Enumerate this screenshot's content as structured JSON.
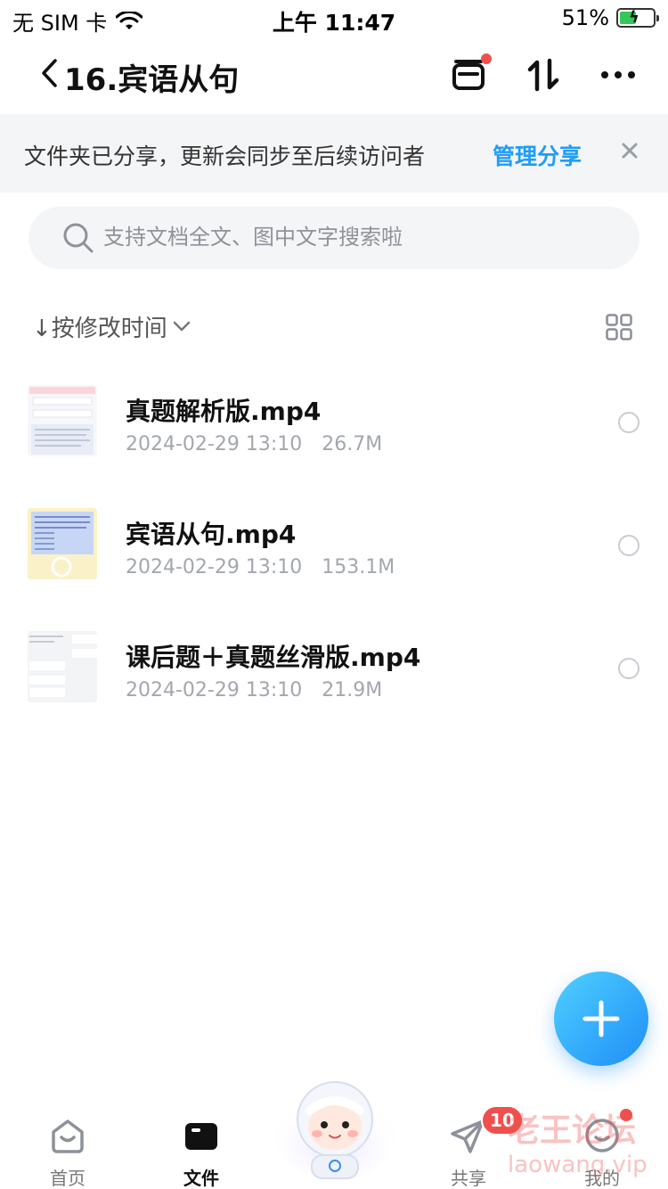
{
  "status_bar": {
    "carrier": "无 SIM 卡",
    "time": "上午 11:47",
    "battery": "51%",
    "battery_level": 0.51
  },
  "navbar": {
    "title": "16.宾语从句",
    "back_icon": "chevron-left-icon",
    "icons": [
      "inbox-box-icon",
      "sort-arrows-icon",
      "more-dots-icon"
    ]
  },
  "banner": {
    "message": "文件夹已分享，更新会同步至后续访问者",
    "action": "管理分享"
  },
  "search": {
    "placeholder": "支持文档全文、图中文字搜索啦"
  },
  "sort": {
    "label": "↓按修改时间"
  },
  "files": [
    {
      "name": "真题解析版.mp4",
      "date": "2024-02-29 13:10",
      "size": "26.7M"
    },
    {
      "name": "宾语从句.mp4",
      "date": "2024-02-29 13:10",
      "size": "153.1M"
    },
    {
      "name": "课后题＋真题丝滑版.mp4",
      "date": "2024-02-29 13:10",
      "size": "21.9M"
    }
  ],
  "tabbar": {
    "home": "首页",
    "files": "文件",
    "share": "共享",
    "mine": "我的",
    "share_badge": "10"
  },
  "watermark": {
    "line1": "老王论坛",
    "line2": "laowang.vip"
  },
  "colors": {
    "accent": "#1f9df7",
    "badge": "#f0504d",
    "meta_text": "#a3a7ad"
  }
}
